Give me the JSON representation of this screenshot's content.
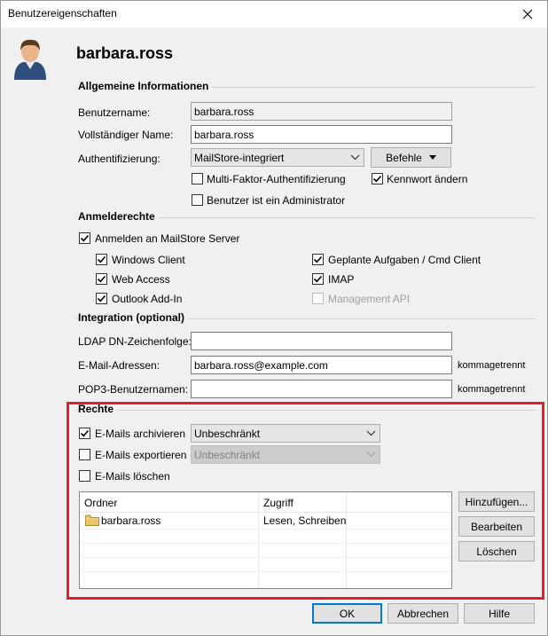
{
  "window": {
    "title": "Benutzereigenschaften"
  },
  "user": {
    "name": "barbara.ross"
  },
  "sections": {
    "general": "Allgemeine Informationen",
    "login": "Anmelderechte",
    "integration": "Integration (optional)",
    "rights": "Rechte"
  },
  "general": {
    "username_label": "Benutzername:",
    "username_value": "barbara.ross",
    "fullname_label": "Vollständiger Name:",
    "fullname_value": "barbara.ross",
    "auth_label": "Authentifizierung:",
    "auth_value": "MailStore-integriert",
    "commands_label": "Befehle",
    "mfa_label": "Multi-Faktor-Authentifizierung",
    "mfa_checked": false,
    "change_pw_label": "Kennwort ändern",
    "change_pw_checked": true,
    "admin_label": "Benutzer ist ein Administrator",
    "admin_checked": false
  },
  "login": {
    "server_label": "Anmelden an MailStore Server",
    "server_checked": true,
    "windows_client": "Windows Client",
    "web_access": "Web Access",
    "outlook_addin": "Outlook Add-In",
    "scheduled_tasks": "Geplante Aufgaben / Cmd Client",
    "imap": "IMAP",
    "management_api": "Management API"
  },
  "integration": {
    "ldap_label": "LDAP DN-Zeichenfolge:",
    "ldap_value": "",
    "email_label": "E-Mail-Adressen:",
    "email_value": "barbara.ross@example.com",
    "email_hint": "kommagetrennt",
    "pop3_label": "POP3-Benutzernamen:",
    "pop3_value": "",
    "pop3_hint": "kommagetrennt"
  },
  "rights": {
    "archive_label": "E-Mails archivieren",
    "archive_checked": true,
    "archive_value": "Unbeschränkt",
    "export_label": "E-Mails exportieren",
    "export_checked": false,
    "export_value": "Unbeschränkt",
    "delete_label": "E-Mails löschen",
    "delete_checked": false,
    "table": {
      "headers": [
        "Ordner",
        "Zugriff"
      ],
      "rows": [
        {
          "folder": "barbara.ross",
          "access": "Lesen, Schreiben"
        }
      ]
    },
    "add_button": "Hinzufügen...",
    "edit_button": "Bearbeiten",
    "delete_button": "Löschen"
  },
  "footer": {
    "ok": "OK",
    "cancel": "Abbrechen",
    "help": "Hilfe"
  },
  "colors": {
    "highlight_border": "#e0202a",
    "focus_border": "#0078d7"
  },
  "icons": {
    "user_avatar": "user-avatar-icon",
    "folder": "folder-icon",
    "close": "close-icon",
    "dropdown": "chevron-down-icon",
    "check": "checkmark-icon"
  }
}
